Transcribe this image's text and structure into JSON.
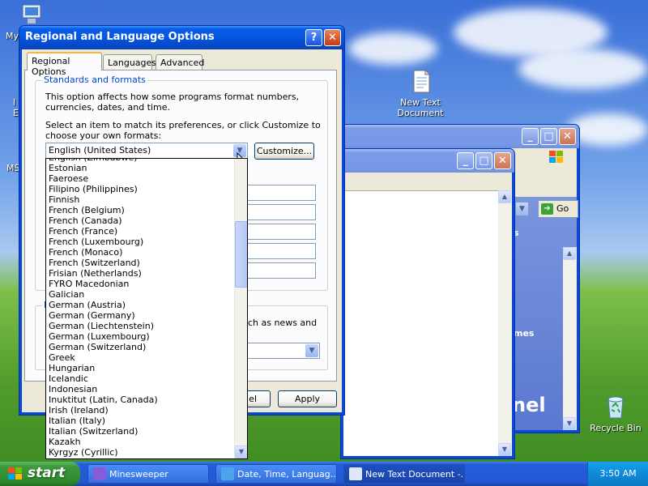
{
  "desktop": {
    "icon_new_text_document": "New Text\nDocument",
    "icon_recycle_bin": "Recycle Bin",
    "frag_my": "My",
    "frag_i": "I",
    "frag_e": "E",
    "frag_ms": "MS",
    "frag_bg_go": "Go",
    "frag_bg_s": "s",
    "frag_bg_mes": "mes",
    "frag_bg_nel": "nel",
    "frag_bg_cut1": "uch as news and"
  },
  "dialog": {
    "title": "Regional and Language Options",
    "help_btn": "?",
    "close_btn": "✕",
    "tabs": [
      "Regional Options",
      "Languages",
      "Advanced"
    ],
    "group_standards": "Standards and formats",
    "desc1": "This option affects how some programs format numbers, currencies, dates, and time.",
    "desc2": "Select an item to match its preferences, or click Customize to choose your own formats:",
    "selected_locale": "English (United States)",
    "customize_btn": "Customize...",
    "group_location_frag": "L",
    "cancel_btn_frag": "el",
    "apply_btn": "Apply"
  },
  "dropdown": {
    "items": [
      "English (Zimbabwe)",
      "Estonian",
      "Faeroese",
      "Filipino (Philippines)",
      "Finnish",
      "French (Belgium)",
      "French (Canada)",
      "French (France)",
      "French (Luxembourg)",
      "French (Monaco)",
      "French (Switzerland)",
      "Frisian (Netherlands)",
      "FYRO Macedonian",
      "Galician",
      "German (Austria)",
      "German (Germany)",
      "German (Liechtenstein)",
      "German (Luxembourg)",
      "German (Switzerland)",
      "Greek",
      "Hungarian",
      "Icelandic",
      "Indonesian",
      "Inuktitut (Latin, Canada)",
      "Irish (Ireland)",
      "Italian (Italy)",
      "Italian (Switzerland)",
      "Kazakh",
      "Kyrgyz (Cyrillic)"
    ]
  },
  "taskbar": {
    "start_label": "start",
    "tasks": [
      "Minesweeper",
      "Date, Time, Languag...",
      "New Text Document -..."
    ],
    "clock": "3:50 AM"
  },
  "colors": {
    "xp_blue": "#0a5ce6",
    "taskbar_blue": "#245edb",
    "start_green": "#3c9a3c",
    "dialog_face": "#ece9d8"
  }
}
